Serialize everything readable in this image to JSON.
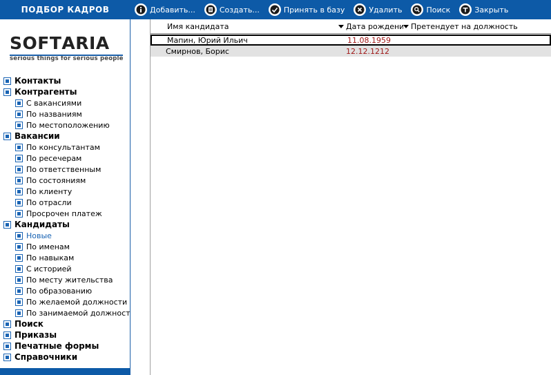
{
  "app": {
    "title": "ПОДБОР КАДРОВ"
  },
  "toolbar": {
    "buttons": [
      {
        "label": "Добавить...",
        "icon": "info-icon"
      },
      {
        "label": "Создать...",
        "icon": "new-icon"
      },
      {
        "label": "Принять в базу",
        "icon": "accept-icon"
      },
      {
        "label": "Удалить",
        "icon": "delete-icon"
      },
      {
        "label": "Поиск",
        "icon": "search-icon"
      },
      {
        "label": "Закрыть",
        "icon": "close-icon"
      }
    ]
  },
  "logo": {
    "word_left": "SOFT",
    "word_mid": "A",
    "word_right": "RIA",
    "tagline": "serious things for serious people"
  },
  "nav": [
    {
      "label": "Контакты",
      "level": 0
    },
    {
      "label": "Контрагенты",
      "level": 0
    },
    {
      "label": "С вакансиями",
      "level": 1
    },
    {
      "label": "По названиям",
      "level": 1
    },
    {
      "label": "По местоположению",
      "level": 1
    },
    {
      "label": "Вакансии",
      "level": 0
    },
    {
      "label": "По консультантам",
      "level": 1
    },
    {
      "label": "По ресечерам",
      "level": 1
    },
    {
      "label": "По ответственным",
      "level": 1
    },
    {
      "label": "По состояниям",
      "level": 1
    },
    {
      "label": "По клиенту",
      "level": 1
    },
    {
      "label": "По отрасли",
      "level": 1
    },
    {
      "label": "Просрочен платеж",
      "level": 1
    },
    {
      "label": "Кандидаты",
      "level": 0
    },
    {
      "label": "Новые",
      "level": 1,
      "active": true
    },
    {
      "label": "По именам",
      "level": 1
    },
    {
      "label": "По навыкам",
      "level": 1
    },
    {
      "label": "С историей",
      "level": 1
    },
    {
      "label": "По месту жительства",
      "level": 1
    },
    {
      "label": "По образованию",
      "level": 1
    },
    {
      "label": "По желаемой должности",
      "level": 1
    },
    {
      "label": "По занимаемой должности",
      "level": 1
    },
    {
      "label": "Поиск",
      "level": 0
    },
    {
      "label": "Приказы",
      "level": 0
    },
    {
      "label": "Печатные формы",
      "level": 0
    },
    {
      "label": "Справочники",
      "level": 0
    }
  ],
  "grid": {
    "columns": {
      "name": "Имя кандидата",
      "date": "Дата рождени",
      "position": "Претендует на должность"
    },
    "rows": [
      {
        "name": "Мапин, Юрий Ильич",
        "date": "11.08.1959",
        "position": ""
      },
      {
        "name": "Смирнов, Борис",
        "date": "12.12.1212",
        "position": ""
      }
    ]
  },
  "colors": {
    "brand_blue": "#0d5aa7",
    "accent_blue": "#1a64b4",
    "date_red": "#a01818",
    "row_alt_gray": "#e2e2e2"
  }
}
